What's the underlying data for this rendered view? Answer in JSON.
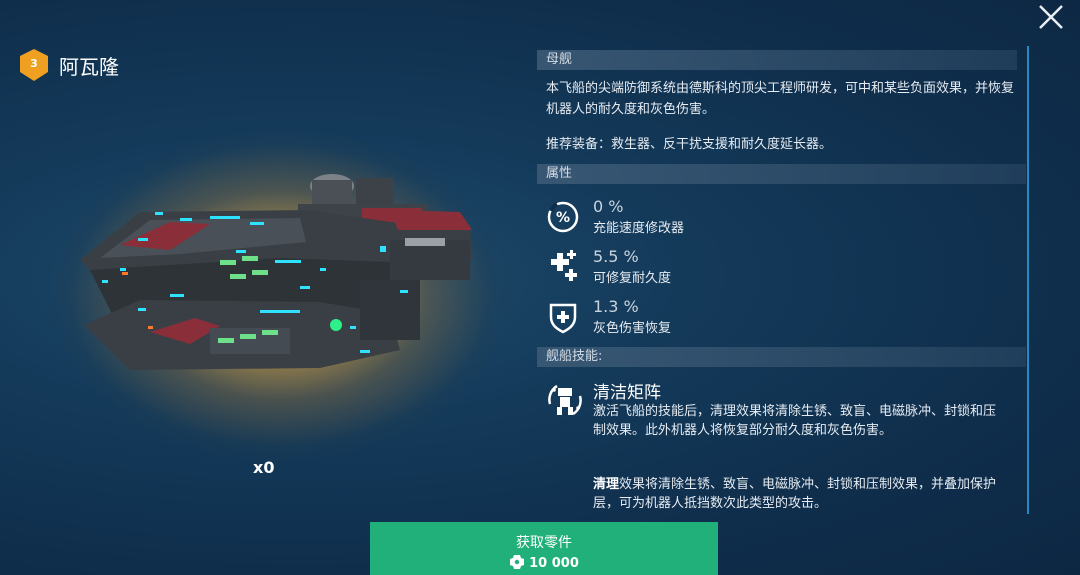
{
  "header": {
    "level": "3",
    "name": "阿瓦隆"
  },
  "ship": {
    "count": "x0"
  },
  "panel": {
    "section_type": "母舰",
    "description": "本飞船的尖端防御系统由德斯科的顶尖工程师研发，可中和某些负面效果，并恢复机器人的耐久度和灰色伤害。",
    "recommended": "推荐装备：救生器、反干扰支援和耐久度延长器。",
    "section_attrs": "属性",
    "stats": [
      {
        "value": "0 %",
        "label": "充能速度修改器",
        "icon": "percent-circle-icon"
      },
      {
        "value": "5.5 %",
        "label": "可修复耐久度",
        "icon": "repair-plus-icon"
      },
      {
        "value": "1.3 %",
        "label": "灰色伤害恢复",
        "icon": "shield-plus-icon"
      }
    ],
    "section_skill": "舰船技能:",
    "skill": {
      "title": "清洁矩阵",
      "icon": "robot-cleanse-icon",
      "description": "激活飞船的技能后，清理效果将清除生锈、致盲、电磁脉冲、封锁和压制效果。此外机器人将恢复部分耐久度和灰色伤害。",
      "note_bold": "清理",
      "note": "效果将清除生锈、致盲、电磁脉冲、封锁和压制效果，并叠加保护层，可为机器人抵挡数次此类型的攻击。"
    }
  },
  "button": {
    "label": "获取零件",
    "price": "10 000",
    "price_icon": "component-icon"
  },
  "colors": {
    "accent_green": "#21b07a",
    "badge_orange": "#f0a020",
    "scroll_blue": "#2c9ad8"
  }
}
